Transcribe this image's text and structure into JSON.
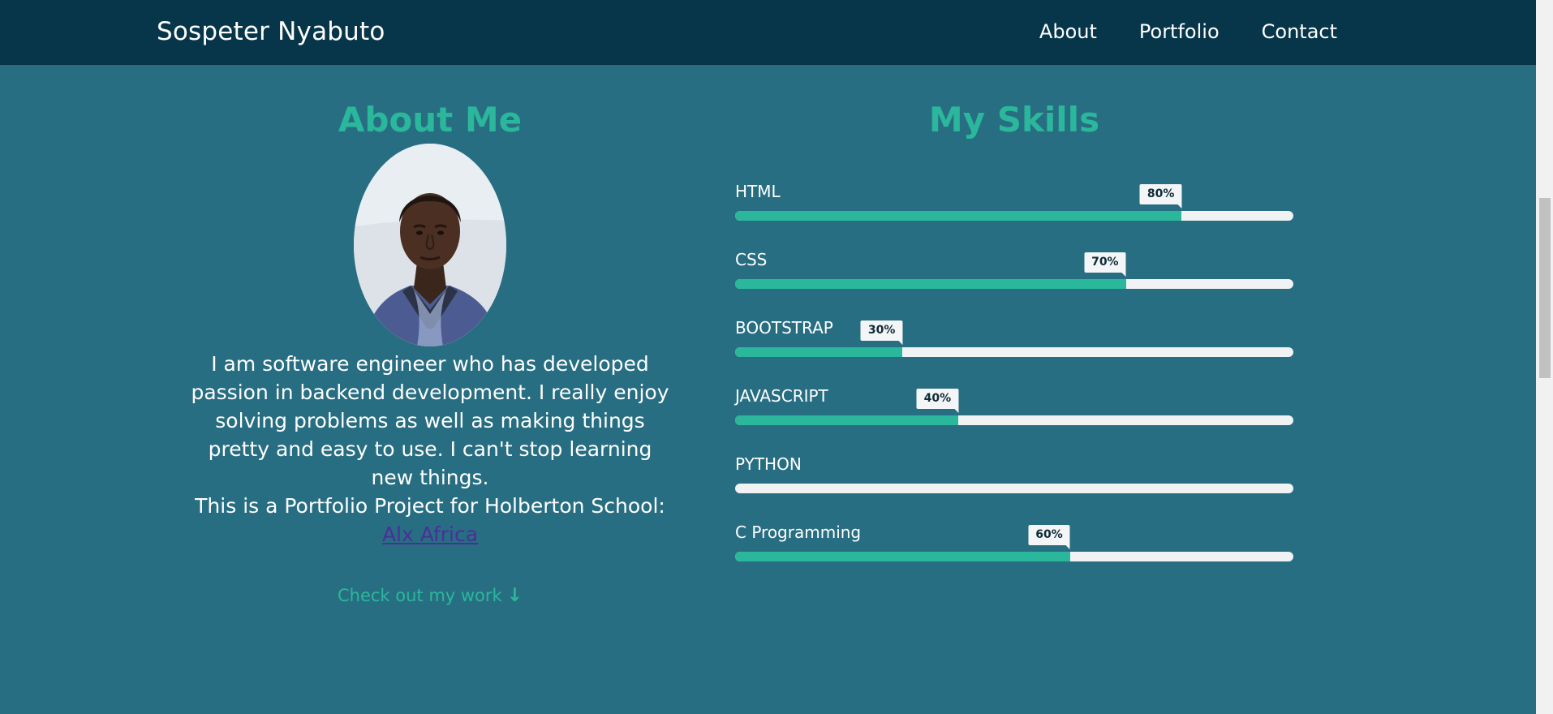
{
  "header": {
    "brand": "Sospeter Nyabuto",
    "nav": [
      {
        "label": "About"
      },
      {
        "label": "Portfolio"
      },
      {
        "label": "Contact"
      }
    ]
  },
  "about": {
    "title": "About Me",
    "bio": "I am software engineer who has developed passion in backend development. I really enjoy solving problems as well as making things pretty and easy to use. I can't stop learning new things.",
    "project_prefix": "This is a Portfolio Project for Holberton School: ",
    "project_link": "Alx Africa",
    "cta": "Check out my work",
    "cta_icon": "arrow-down-icon"
  },
  "skills": {
    "title": "My Skills",
    "items": [
      {
        "name": "HTML",
        "percent": 80,
        "label": "80%"
      },
      {
        "name": "CSS",
        "percent": 70,
        "label": "70%"
      },
      {
        "name": "BOOTSTRAP",
        "percent": 30,
        "label": "30%"
      },
      {
        "name": "JAVASCRIPT",
        "percent": 40,
        "label": "40%"
      },
      {
        "name": "PYTHON",
        "percent": 0,
        "label": ""
      },
      {
        "name": "C Programming",
        "percent": 60,
        "label": "60%"
      }
    ]
  },
  "colors": {
    "header_bg": "#07364a",
    "page_bg": "#286e82",
    "accent": "#2bb79b",
    "link": "#4b2f98",
    "bar_track": "#f0f2f4"
  }
}
